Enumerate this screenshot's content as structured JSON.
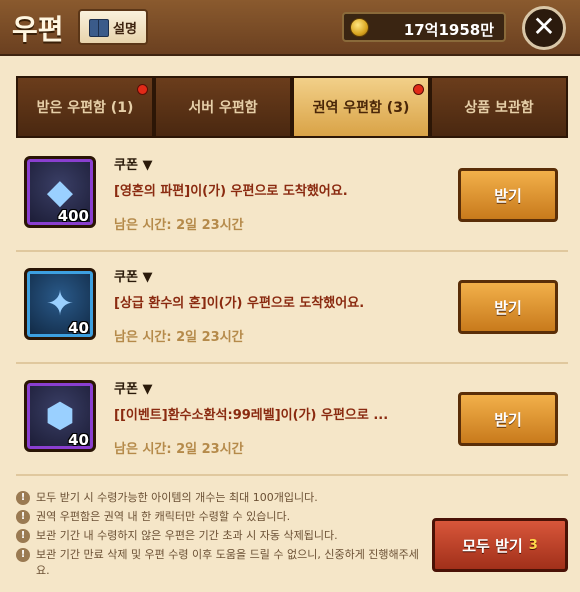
{
  "header": {
    "title": "우편",
    "help_label": "설명",
    "currency": "17억1958만"
  },
  "tabs": [
    {
      "label": "받은 우편함 (1)",
      "active": false,
      "dot": true
    },
    {
      "label": "서버 우편함",
      "active": false,
      "dot": false
    },
    {
      "label": "권역 우편함 (3)",
      "active": true,
      "dot": true
    },
    {
      "label": "상품 보관함",
      "active": false,
      "dot": false
    }
  ],
  "mails": [
    {
      "type": "쿠폰 ▼",
      "message": "[영혼의 파편]이(가) 우편으로 도착했어요.",
      "time": "남은 시간: 2일 23시간",
      "qty": "400",
      "button": "받기",
      "icon": "soul-shard-icon"
    },
    {
      "type": "쿠폰 ▼",
      "message": "[상급 환수의 혼]이(가) 우편으로 도착했어요.",
      "time": "남은 시간: 2일 23시간",
      "qty": "40",
      "button": "받기",
      "icon": "summon-soul-icon"
    },
    {
      "type": "쿠폰 ▼",
      "message": "[[이벤트]환수소환석:99레벨]이(가) 우편으로 ...",
      "time": "남은 시간: 2일 23시간",
      "qty": "40",
      "button": "받기",
      "icon": "summon-stone-icon"
    }
  ],
  "notices": [
    "모두 받기 시 수령가능한 아이템의 개수는 최대 100개입니다.",
    "권역 우편함은 권역 내 한 캐릭터만 수령할 수 있습니다.",
    "보관 기간 내 수령하지 않은 우편은 기간 초과 시 자동 삭제됩니다.",
    "보관 기간 만료 삭제 및 우편 수령 이후 도움을 드릴 수 없으니, 신중하게 진행해주세요."
  ],
  "receive_all": {
    "label": "모두 받기",
    "count": "3"
  }
}
